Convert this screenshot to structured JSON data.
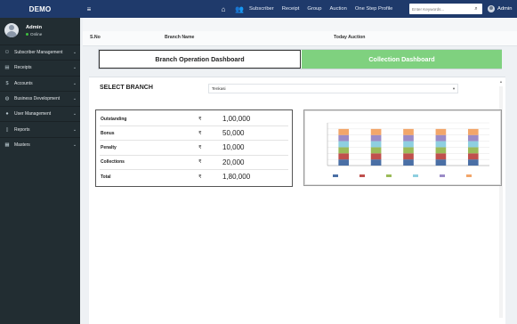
{
  "header": {
    "brand": "DEMO",
    "nav": [
      {
        "label": "Subscriber"
      },
      {
        "label": "Receipt"
      },
      {
        "label": "Group"
      },
      {
        "label": "Auction"
      },
      {
        "label": "One Step Profile"
      }
    ],
    "search_placeholder": "Enter Keywords...",
    "user_name": "Admin"
  },
  "sidebar": {
    "user": {
      "name": "Admin",
      "status": "Online"
    },
    "items": [
      {
        "label": "Subscriber Management",
        "icon": "users-icon"
      },
      {
        "label": "Receipts",
        "icon": "receipt-icon"
      },
      {
        "label": "Accounts",
        "icon": "dollar-icon"
      },
      {
        "label": "Business Development",
        "icon": "globe-icon"
      },
      {
        "label": "User Management",
        "icon": "user-icon"
      },
      {
        "label": "Reports",
        "icon": "file-icon"
      },
      {
        "label": "Masters",
        "icon": "book-icon"
      }
    ]
  },
  "table_header": {
    "sno": "S.No",
    "branch": "Branch Name",
    "auction": "Today Auction"
  },
  "dashboard_toggle": {
    "branch_label": "Branch Operation Dashboard",
    "collection_label": "Collection Dashboard",
    "colors": {
      "collection": "#7fd17f"
    }
  },
  "branch_select": {
    "label": "SELECT BRANCH",
    "value": "Tenkasi"
  },
  "stats": [
    {
      "name": "Outstanding",
      "currency": "₹",
      "value": "1,00,000"
    },
    {
      "name": "Bonus",
      "currency": "₹",
      "value": "50,000"
    },
    {
      "name": "Penalty",
      "currency": "₹",
      "value": "10,000"
    },
    {
      "name": "Collections",
      "currency": "₹",
      "value": "20,000"
    },
    {
      "name": "Total",
      "currency": "₹",
      "value": "1,80,000"
    }
  ],
  "chart_data": {
    "type": "bar",
    "stacked": true,
    "categories": [
      "",
      "",
      "",
      "",
      ""
    ],
    "series": [
      {
        "color": "#4a6fa5",
        "values": [
          2,
          2,
          2,
          2,
          2
        ]
      },
      {
        "color": "#c0504d",
        "values": [
          2,
          2,
          2,
          2,
          2
        ]
      },
      {
        "color": "#9bbb59",
        "values": [
          2,
          2,
          2,
          2,
          2
        ]
      },
      {
        "color": "#8ecfe0",
        "values": [
          2,
          2,
          2,
          2,
          2
        ]
      },
      {
        "color": "#9b8bc7",
        "values": [
          2,
          2,
          2,
          2,
          2
        ]
      },
      {
        "color": "#f2a66a",
        "values": [
          2,
          2,
          2,
          2,
          2
        ]
      }
    ],
    "ylim": [
      0,
      14
    ],
    "grid": true,
    "legend": "bottom"
  }
}
